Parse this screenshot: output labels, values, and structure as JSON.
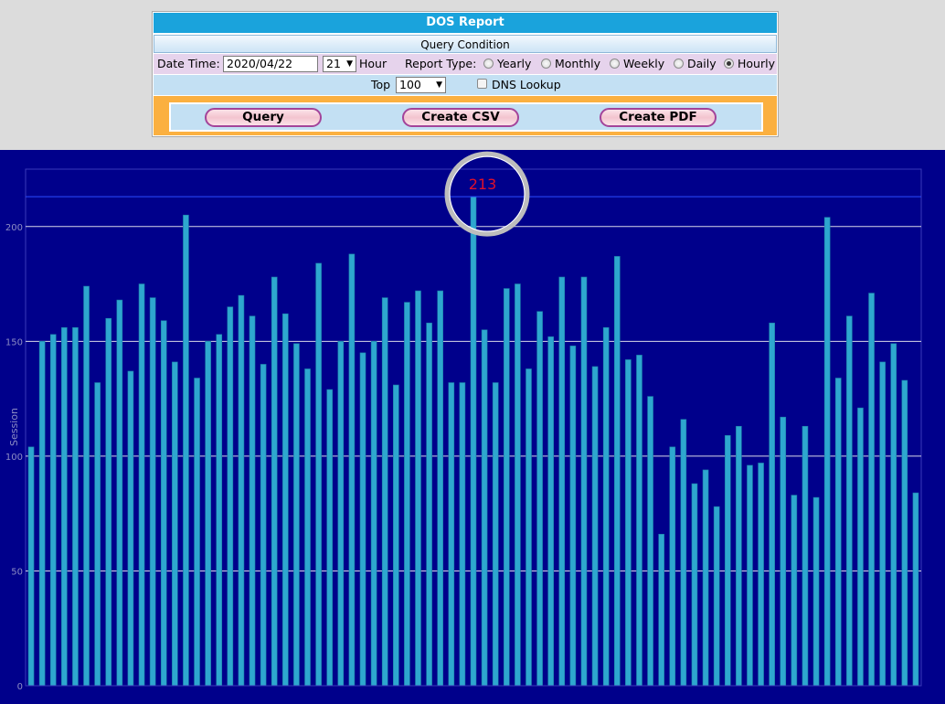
{
  "report": {
    "title": "DOS Report",
    "condition_title": "Query Condition"
  },
  "form": {
    "date_label": "Date Time:",
    "date_value": "2020/04/22",
    "hour_value": "21",
    "hour_label": "Hour",
    "report_type_label": "Report Type:",
    "report_types": [
      {
        "label": "Yearly",
        "checked": false
      },
      {
        "label": "Monthly",
        "checked": false
      },
      {
        "label": "Weekly",
        "checked": false
      },
      {
        "label": "Daily",
        "checked": false
      },
      {
        "label": "Hourly",
        "checked": true
      }
    ],
    "top_label": "Top",
    "top_value": "100",
    "dns_label": "DNS Lookup",
    "dns_checked": false
  },
  "buttons": {
    "query": "Query",
    "csv": "Create CSV",
    "pdf": "Create PDF"
  },
  "colors": {
    "title_bar": "#1aa3dc",
    "chart_bg": "#00008b",
    "bar": "#2ea7cf",
    "highlight_text": "#e0102a",
    "button_frame": "#fbb040"
  },
  "chart_data": {
    "type": "bar",
    "ylabel": "Session",
    "ylim": [
      0,
      225
    ],
    "yticks": [
      0,
      50,
      100,
      150,
      200
    ],
    "grid": true,
    "highlight": {
      "index": 40,
      "value": 213,
      "label": "213"
    },
    "values": [
      104,
      150,
      153,
      156,
      156,
      174,
      132,
      160,
      168,
      137,
      175,
      169,
      159,
      141,
      205,
      134,
      150,
      153,
      165,
      170,
      161,
      140,
      178,
      162,
      149,
      138,
      184,
      129,
      150,
      188,
      145,
      150,
      169,
      131,
      167,
      172,
      158,
      172,
      132,
      132,
      213,
      155,
      132,
      173,
      175,
      138,
      163,
      152,
      178,
      148,
      178,
      139,
      156,
      187,
      142,
      144,
      126,
      66,
      104,
      116,
      88,
      94,
      78,
      109,
      113,
      96,
      97,
      158,
      117,
      83,
      113,
      82,
      204,
      134,
      161,
      121,
      171,
      141,
      149,
      133,
      84
    ]
  }
}
